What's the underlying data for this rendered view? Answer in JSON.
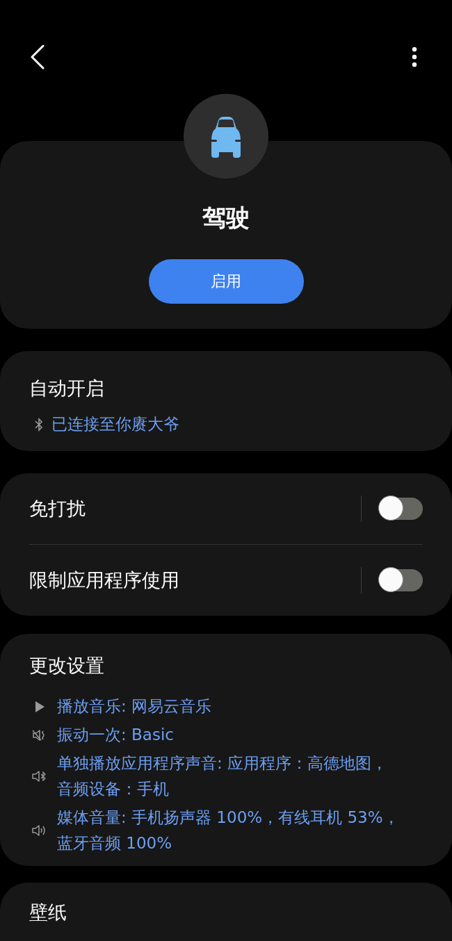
{
  "header": {
    "title": "驾驶",
    "button": "启用"
  },
  "auto_start": {
    "title": "自动开启",
    "condition": "已连接至你赓大爷"
  },
  "toggles": [
    {
      "label": "免打扰",
      "on": false
    },
    {
      "label": "限制应用程序使用",
      "on": false
    }
  ],
  "change_settings": {
    "title": "更改设置",
    "items": [
      {
        "kind": "play",
        "text": "播放音乐: 网易云音乐"
      },
      {
        "kind": "vibrate",
        "text": "振动一次: Basic"
      },
      {
        "kind": "separate-sound",
        "text": "单独播放应用程序声音: 应用程序：高德地图，音频设备：手机"
      },
      {
        "kind": "volume",
        "text": "媒体音量: 手机扬声器 100%，有线耳机 53%，蓝牙音频 100%"
      }
    ]
  },
  "wallpaper": {
    "title": "壁纸"
  }
}
